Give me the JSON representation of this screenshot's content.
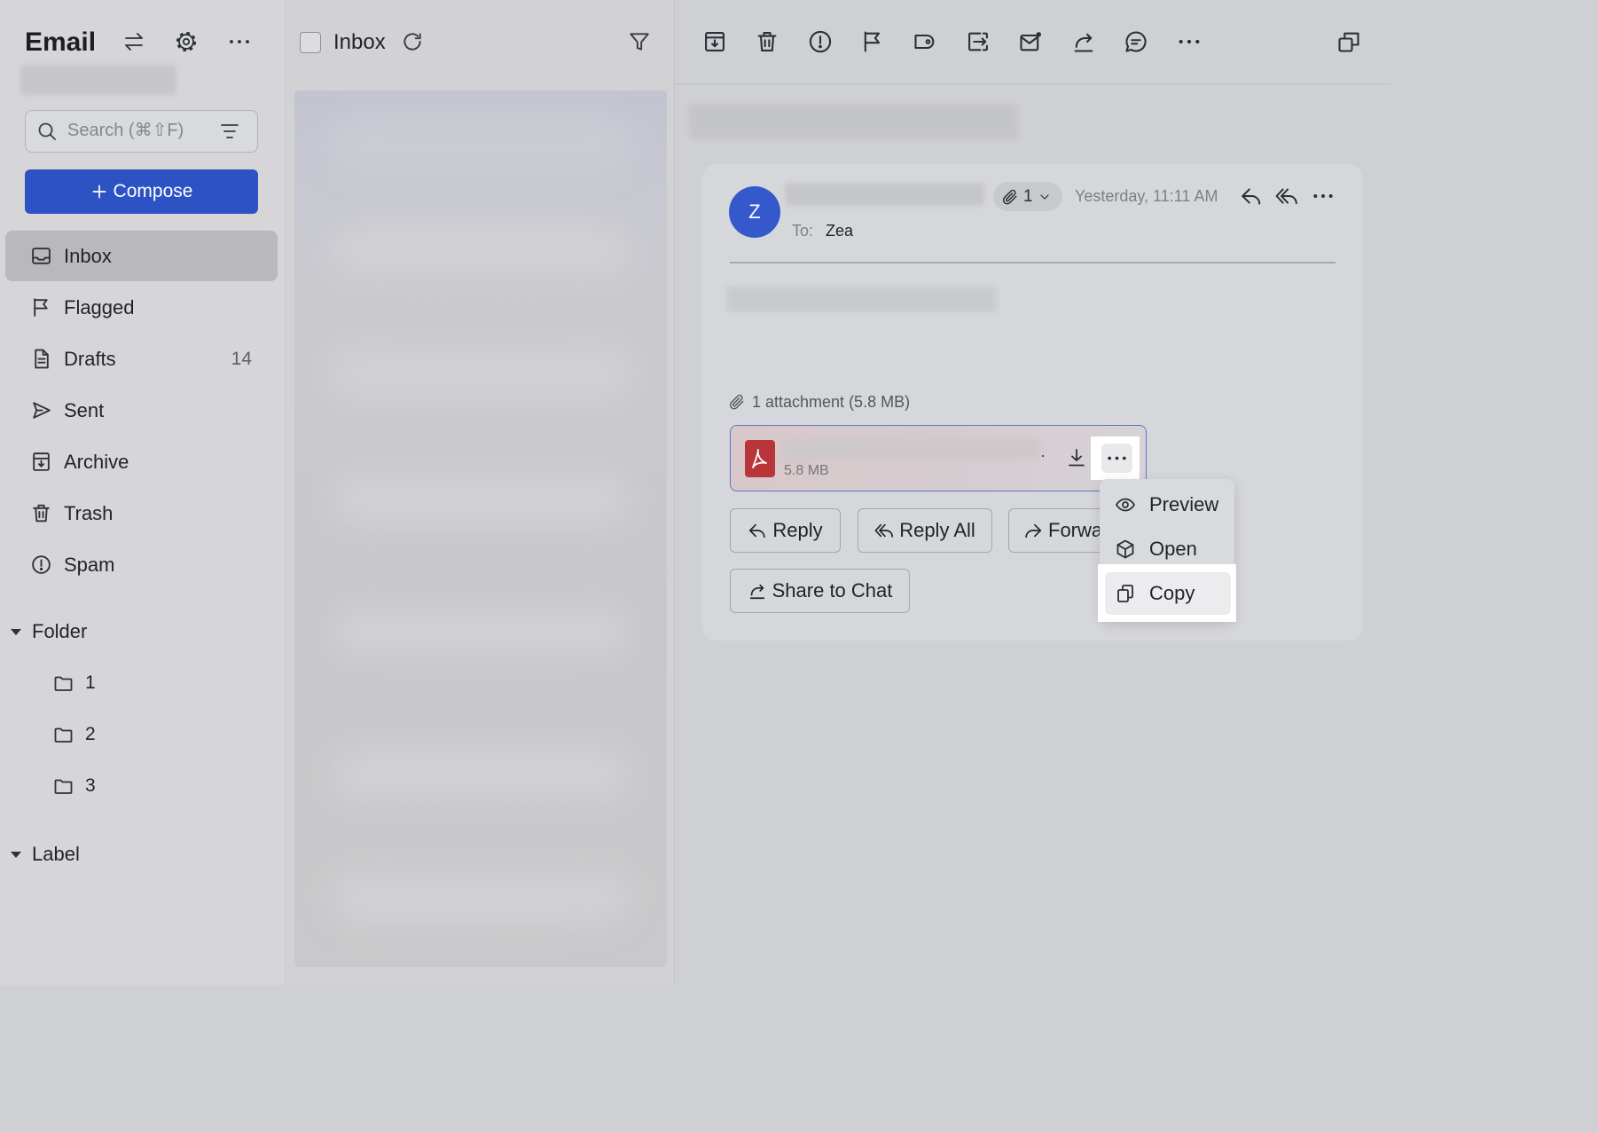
{
  "app": {
    "title": "Email"
  },
  "sidebar": {
    "header_icons": [
      "swap-icon",
      "gear-icon",
      "more-icon"
    ],
    "search": {
      "placeholder": "Search (⌘⇧F)",
      "icon": "search-icon",
      "filter_icon": "filter-lines-icon"
    },
    "compose": {
      "label": "Compose",
      "icon": "plus-icon"
    },
    "nav": [
      {
        "label": "Inbox",
        "icon": "inbox-icon",
        "selected": true
      },
      {
        "label": "Flagged",
        "icon": "flag-icon"
      },
      {
        "label": "Drafts",
        "icon": "draft-icon",
        "count": "14"
      },
      {
        "label": "Sent",
        "icon": "send-icon"
      },
      {
        "label": "Archive",
        "icon": "archive-icon"
      },
      {
        "label": "Trash",
        "icon": "trash-icon"
      },
      {
        "label": "Spam",
        "icon": "spam-icon"
      }
    ],
    "folders": {
      "label": "Folder",
      "expanded": true,
      "items": [
        {
          "label": "1"
        },
        {
          "label": "2"
        },
        {
          "label": "3"
        }
      ]
    },
    "labels": {
      "label": "Label",
      "expanded": true
    }
  },
  "message_list": {
    "title": "Inbox",
    "select_all_checked": false,
    "icons": [
      "refresh-icon",
      "filter-icon"
    ]
  },
  "toolbar": {
    "icons": [
      "archive-icon",
      "delete-icon",
      "spam-icon",
      "flag-icon",
      "label-icon",
      "move-icon",
      "mark-unread-icon",
      "share-icon",
      "comment-icon",
      "more-icon",
      "open-in-window-icon"
    ]
  },
  "message": {
    "avatar_initial": "Z",
    "attachment_chip": {
      "count": "1"
    },
    "timestamp": "Yesterday, 11:11 AM",
    "to_label": "To:",
    "to_name": "Zea",
    "attachments_summary": "1 attachment (5.8 MB)",
    "attachment": {
      "icon": "pdf-file-icon",
      "separator": "·",
      "size": "5.8 MB"
    },
    "actions": {
      "reply": "Reply",
      "reply_all": "Reply All",
      "forward": "Forwa",
      "share": "Share to Chat"
    }
  },
  "context_menu": {
    "items": [
      {
        "label": "Preview",
        "icon": "eye-icon"
      },
      {
        "label": "Open",
        "icon": "cube-icon"
      },
      {
        "label": "Copy",
        "icon": "copy-icon",
        "highlighted": true
      }
    ]
  },
  "colors": {
    "accent": "#2d52c4",
    "avatar": "#3558cc",
    "pdf": "#b8363a",
    "selected_nav": "#b9b9bc",
    "highlight": "#ffffff"
  }
}
